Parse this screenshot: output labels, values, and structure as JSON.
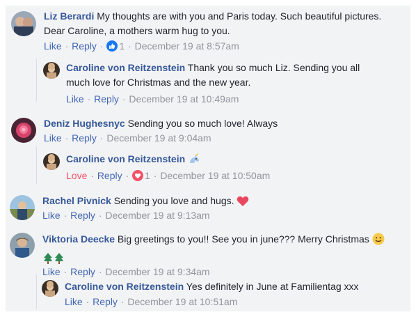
{
  "comments": [
    {
      "author": "Liz Berardi",
      "text_line1": "My thoughts are with you and Paris today. Such beautiful pictures.",
      "text_line2": "Dear Caroline, a mothers warm hug to you.",
      "like": "Like",
      "reply": "Reply",
      "reaction": "like",
      "reaction_count": "1",
      "time": "December 19 at 8:57am"
    },
    {
      "author": "Caroline von Reitzenstein",
      "text_line1": "Thank you so much Liz. Sending you all",
      "text_line2": "much love for Christmas and the new year.",
      "like": "Like",
      "reply": "Reply",
      "time": "December 19 at 10:49am"
    },
    {
      "author": "Deniz Hughesnyc",
      "text": "Sending you so much love! Always",
      "like": "Like",
      "reply": "Reply",
      "time": "December 19 at 9:04am"
    },
    {
      "author": "Caroline von Reitzenstein",
      "emoji": "unicorn-icon",
      "love": "Love",
      "reply": "Reply",
      "reaction": "love",
      "reaction_count": "1",
      "time": "December 19 at 10:50am"
    },
    {
      "author": "Rachel Pivnick",
      "text": "Sending you love and hugs.",
      "emoji": "heart-icon",
      "like": "Like",
      "reply": "Reply",
      "time": "December 19 at 9:13am"
    },
    {
      "author": "Viktoria Deecke",
      "text": "Big greetings to you!! See you in june??? Merry Christmas",
      "emoji": "smile-icon",
      "emoji2": "christmas-tree-icon",
      "like": "Like",
      "reply": "Reply",
      "time": "December 19 at 9:34am"
    },
    {
      "author": "Caroline von Reitzenstein",
      "text": "Yes definitely in June at Familientag xxx",
      "like": "Like",
      "reply": "Reply",
      "time": "December 19 at 10:51am"
    }
  ],
  "dot": "·",
  "colors": {
    "name": "#365899",
    "link": "#4267b2",
    "meta": "#90949c",
    "love": "#f25268",
    "panel": "#f2f3f5"
  }
}
